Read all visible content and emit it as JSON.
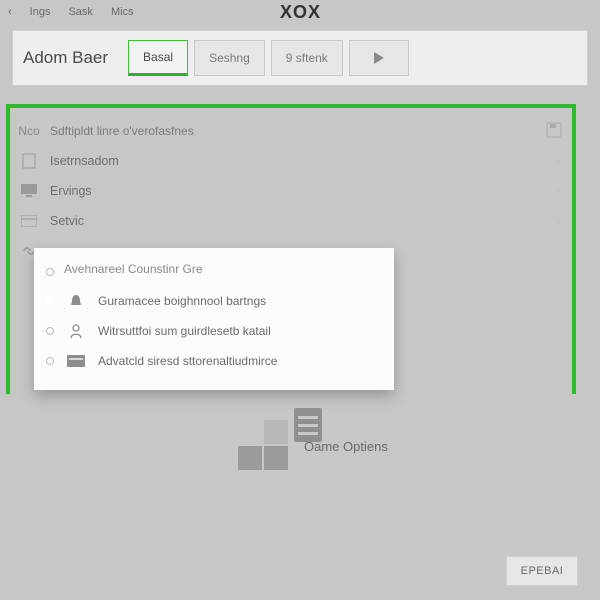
{
  "topnav": {
    "items": [
      "Ings",
      "Sask",
      "Mics"
    ],
    "logo": "XOX"
  },
  "header": {
    "title": "Adom Baer",
    "tabs": [
      {
        "label": "Basal",
        "active": true
      },
      {
        "label": "Seshng",
        "active": false
      },
      {
        "label": "9 sftenk",
        "active": false
      }
    ]
  },
  "list": {
    "header_label": "Nco",
    "rows": [
      {
        "label": "Sdftipldt linre o'verofasfnes"
      },
      {
        "label": "Isetrnsadom"
      },
      {
        "label": "Ervings"
      },
      {
        "label": "Setvic"
      }
    ]
  },
  "popup": {
    "title": "Avehnareel Counstinr Gre",
    "items": [
      {
        "label": "Guramacee boighnnool bartngs"
      },
      {
        "label": "Witrsuttfoi sum guirdlesetb katail"
      },
      {
        "label": "Advatcld siresd sttorenaltiudmirce"
      }
    ]
  },
  "center": {
    "label": "Oame Optiens"
  },
  "footer": {
    "button": "EPEBAI"
  }
}
